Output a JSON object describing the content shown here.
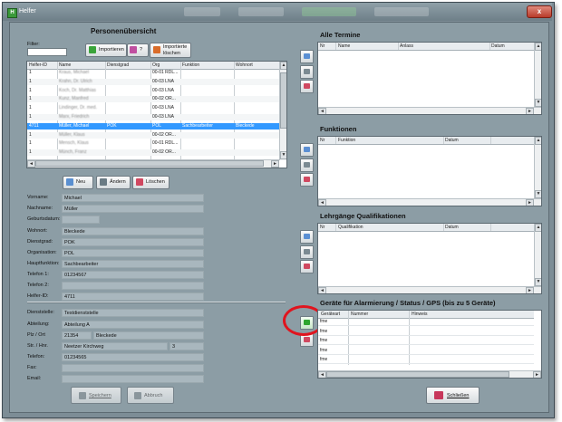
{
  "window": {
    "title": "Helfer",
    "app_icon": "app-icon",
    "close_glyph": "x"
  },
  "personen": {
    "heading": "Personenübersicht",
    "filter_label": "Filter:",
    "filter_value": "",
    "buttons": {
      "importieren": "Importieren",
      "help": "?",
      "importierte_loeschen_line1": "Importierte",
      "importierte_loeschen_line2": "löschen"
    },
    "columns": [
      "Helfer-ID",
      "Name",
      "Dienstgrad",
      "Org",
      "Funktion",
      "Wohnort"
    ],
    "rows": [
      {
        "id": "1",
        "name": "Kraus, Michael",
        "dienstgrad": "",
        "org": "00-01 RDL...",
        "funktion": "",
        "wohnort": "",
        "selected": false,
        "blurred": true
      },
      {
        "id": "1",
        "name": "Krahn, Dr. Ulrich",
        "dienstgrad": "",
        "org": "00-03 LNA",
        "funktion": "",
        "wohnort": "",
        "selected": false,
        "blurred": true
      },
      {
        "id": "1",
        "name": "Koch, Dr. Matthias",
        "dienstgrad": "",
        "org": "00-03 LNA",
        "funktion": "",
        "wohnort": "",
        "selected": false,
        "blurred": true
      },
      {
        "id": "1",
        "name": "Kunz, Manfred",
        "dienstgrad": "",
        "org": "00-02 OR...",
        "funktion": "",
        "wohnort": "",
        "selected": false,
        "blurred": true
      },
      {
        "id": "1",
        "name": "Lindinger, Dr. med.",
        "dienstgrad": "",
        "org": "00-03 LNA",
        "funktion": "",
        "wohnort": "",
        "selected": false,
        "blurred": true
      },
      {
        "id": "1",
        "name": "Marx, Friedrich",
        "dienstgrad": "",
        "org": "00-03 LNA",
        "funktion": "",
        "wohnort": "",
        "selected": false,
        "blurred": true
      },
      {
        "id": "4711",
        "name": "Müller, Michael",
        "dienstgrad": "POK",
        "org": "POL",
        "funktion": "Sachbearbeiter",
        "wohnort": "Bleckede",
        "selected": true,
        "blurred": false
      },
      {
        "id": "1",
        "name": "Müller, Klaus",
        "dienstgrad": "",
        "org": "00-02 OR...",
        "funktion": "",
        "wohnort": "",
        "selected": false,
        "blurred": true
      },
      {
        "id": "1",
        "name": "Mensch, Klaus",
        "dienstgrad": "",
        "org": "00-01 RDL...",
        "funktion": "",
        "wohnort": "",
        "selected": false,
        "blurred": true
      },
      {
        "id": "1",
        "name": "Münch, Franz",
        "dienstgrad": "",
        "org": "00-02 OR...",
        "funktion": "",
        "wohnort": "",
        "selected": false,
        "blurred": true
      }
    ]
  },
  "actions": {
    "neu": "Neu",
    "aendern": "Ändern",
    "loeschen": "Löschen"
  },
  "details": {
    "fields": [
      {
        "label": "Vorname:",
        "value": "Michael"
      },
      {
        "label": "Nachname:",
        "value": "Müller"
      },
      {
        "label": "Geburtsdatum:",
        "value": ""
      },
      {
        "label": "Wohnort:",
        "value": "Bleckede"
      },
      {
        "label": "Dienstgrad:",
        "value": "POK"
      },
      {
        "label": "Organisation:",
        "value": "POL"
      },
      {
        "label": "Hauptfunktion:",
        "value": "Sachbearbeiter"
      },
      {
        "label": "Telefon 1:",
        "value": "01234567"
      },
      {
        "label": "Telefon 2:",
        "value": ""
      },
      {
        "label": "Helfer-ID:",
        "value": "4711"
      }
    ],
    "dienst": {
      "dienststelle_label": "Dienststelle:",
      "dienststelle_value": "Testdienststelle",
      "abteilung_label": "Abteilung:",
      "abteilung_value": "Abteilung A",
      "plz_label": "Plz / Ort",
      "plz_value": "21354",
      "ort_value": "Bleckede",
      "str_label": "Str. / Hnr.",
      "str_value": "Neetzer Kirchweg",
      "hnr_value": "3",
      "telefon_label": "Telefon:",
      "telefon_value": "01234565",
      "fax_label": "Fax:",
      "fax_value": "",
      "email_label": "Email:",
      "email_value": ""
    },
    "speichern": "Speichern",
    "abbruch": "Abbruch"
  },
  "termine": {
    "heading": "Alle Termine",
    "columns": [
      "Nr",
      "Name",
      "Anlass",
      "Datum"
    ]
  },
  "funktionen": {
    "heading": "Funktionen",
    "columns": [
      "Nr",
      "Funktion",
      "Datum"
    ]
  },
  "lehrgaenge": {
    "heading": "Lehrgänge Qualifikationen",
    "columns": [
      "Nr",
      "Qualifikation",
      "Datum"
    ]
  },
  "geraete": {
    "heading": "Geräte für Alarmierung / Status / GPS  (bis zu 5 Geräte)",
    "columns": [
      "Geräteart",
      "Nummer",
      "Hinweis"
    ],
    "rows": [
      "fme",
      "fme",
      "fme",
      "fme",
      "fme"
    ]
  },
  "schliessen": "Schließen",
  "colors": {
    "selection": "#3399ff",
    "annotation_circle": "#e0141e",
    "window_bg": "#8c9da5"
  }
}
